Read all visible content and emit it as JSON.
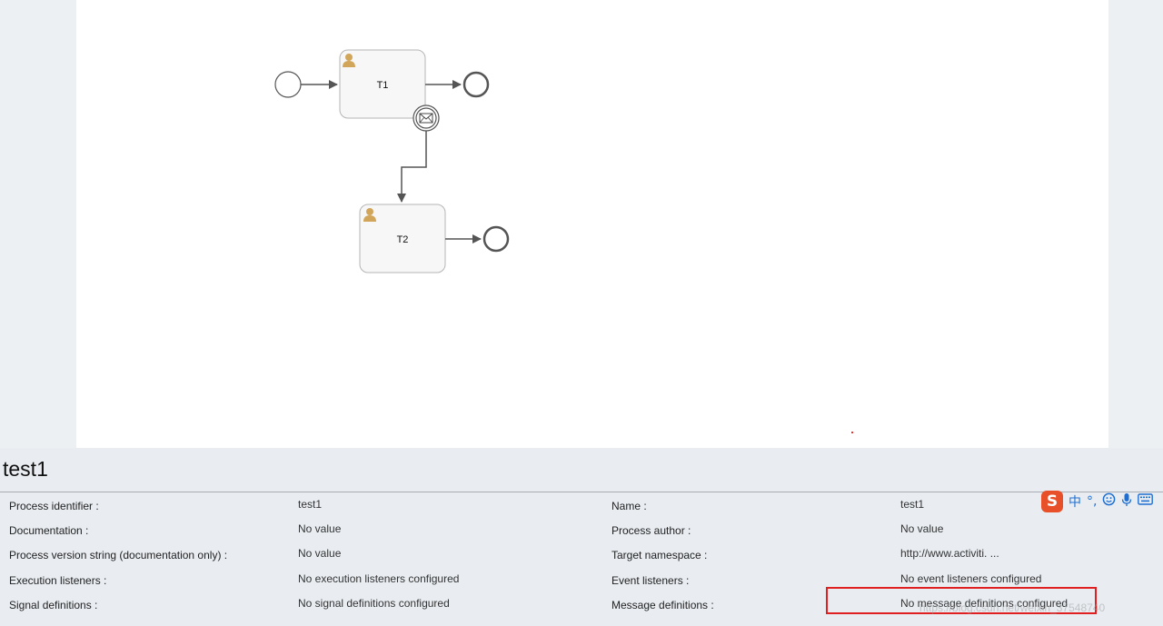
{
  "diagram": {
    "tasks": [
      {
        "id": "T1",
        "label": "T1"
      },
      {
        "id": "T2",
        "label": "T2"
      }
    ]
  },
  "process": {
    "title": "test1",
    "left_rows": [
      {
        "label": "Process identifier :",
        "value": "test1"
      },
      {
        "label": "Documentation :",
        "value": "No value"
      },
      {
        "label": "Process version string (documentation only) :",
        "value": "No value"
      },
      {
        "label": "Execution listeners :",
        "value": "No execution listeners configured"
      },
      {
        "label": "Signal definitions :",
        "value": "No signal definitions configured"
      }
    ],
    "right_rows": [
      {
        "label": "Name :",
        "value": "test1"
      },
      {
        "label": "Process author :",
        "value": "No value"
      },
      {
        "label": "Target namespace :",
        "value": "http://www.activiti. ..."
      },
      {
        "label": "Event listeners :",
        "value": "No event listeners configured"
      },
      {
        "label": "Message definitions :",
        "value": "No message definitions configured"
      }
    ]
  },
  "ime": {
    "logo": "S",
    "mode": "中",
    "punct": "°,",
    "icons": [
      "smiley-icon",
      "microphone-icon",
      "keyboard-icon"
    ]
  },
  "watermark": "https://blog.csdn.net/weixin_37548740",
  "colors": {
    "highlight": "#e02020",
    "task_fill": "#f7f7f7",
    "user_icon": "#d1a55a",
    "ime_logo": "#e8502a"
  }
}
